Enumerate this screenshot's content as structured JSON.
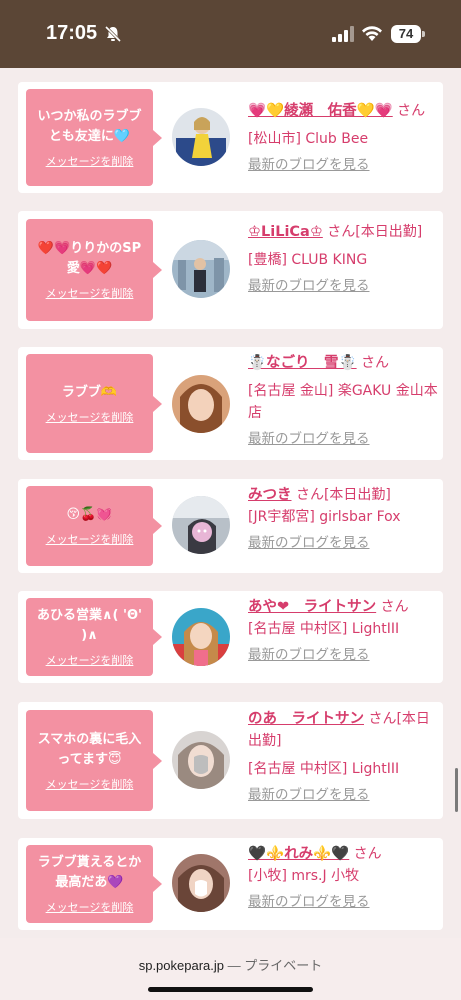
{
  "status_bar": {
    "time": "17:05",
    "battery": "74"
  },
  "browser": {
    "domain": "sp.pokepara.jp",
    "separator": "—",
    "mode": "プライベート"
  },
  "colors": {
    "bubble": "#f391a2",
    "name": "#d63d6c",
    "header": "#5b4636"
  },
  "messages": [
    {
      "message": "いつか私のラブブとも友達に🩵",
      "delete_label": "メッセージを削除",
      "name": "💗💛綾瀬　佑香💛💗",
      "suffix": "さん",
      "shop": "[松山市] Club Bee",
      "blog_label": "最新のブログを見る"
    },
    {
      "message": "❤️💗りりかのSP愛💗❤️",
      "delete_label": "メッセージを削除",
      "name": "♔LiLiCa♔",
      "suffix": "さん[本日出勤]",
      "shop": "[豊橋] CLUB KING",
      "blog_label": "最新のブログを見る"
    },
    {
      "message": "ラブブ🫶",
      "delete_label": "メッセージを削除",
      "name": "☃️なごり　雪☃️",
      "suffix": "さん",
      "shop": "[名古屋 金山] 楽GAKU 金山本店",
      "blog_label": "最新のブログを見る"
    },
    {
      "message": "😚🍒💓",
      "delete_label": "メッセージを削除",
      "name": "みつき",
      "suffix": "さん[本日出勤]",
      "shop": "[JR宇都宮] girlsbar Fox",
      "blog_label": "最新のブログを見る"
    },
    {
      "message": "あひる営業∧( 'Θ' )∧",
      "delete_label": "メッセージを削除",
      "name": "あや❤︎　ライトサン",
      "suffix": "さん",
      "shop": "[名古屋 中村区] LightIII",
      "blog_label": "最新のブログを見る"
    },
    {
      "message": "スマホの裏に毛入ってます😇",
      "delete_label": "メッセージを削除",
      "name": "のあ　ライトサン",
      "suffix": "さん[本日出勤]",
      "shop": "[名古屋 中村区] LightIII",
      "blog_label": "最新のブログを見る"
    },
    {
      "message": "ラブブ貰えるとか最高だあ💜",
      "delete_label": "メッセージを削除",
      "name": "🖤⚜️れみ⚜️🖤",
      "suffix": "さん",
      "shop": "[小牧] mrs.J 小牧",
      "blog_label": "最新のブログを見る"
    }
  ]
}
